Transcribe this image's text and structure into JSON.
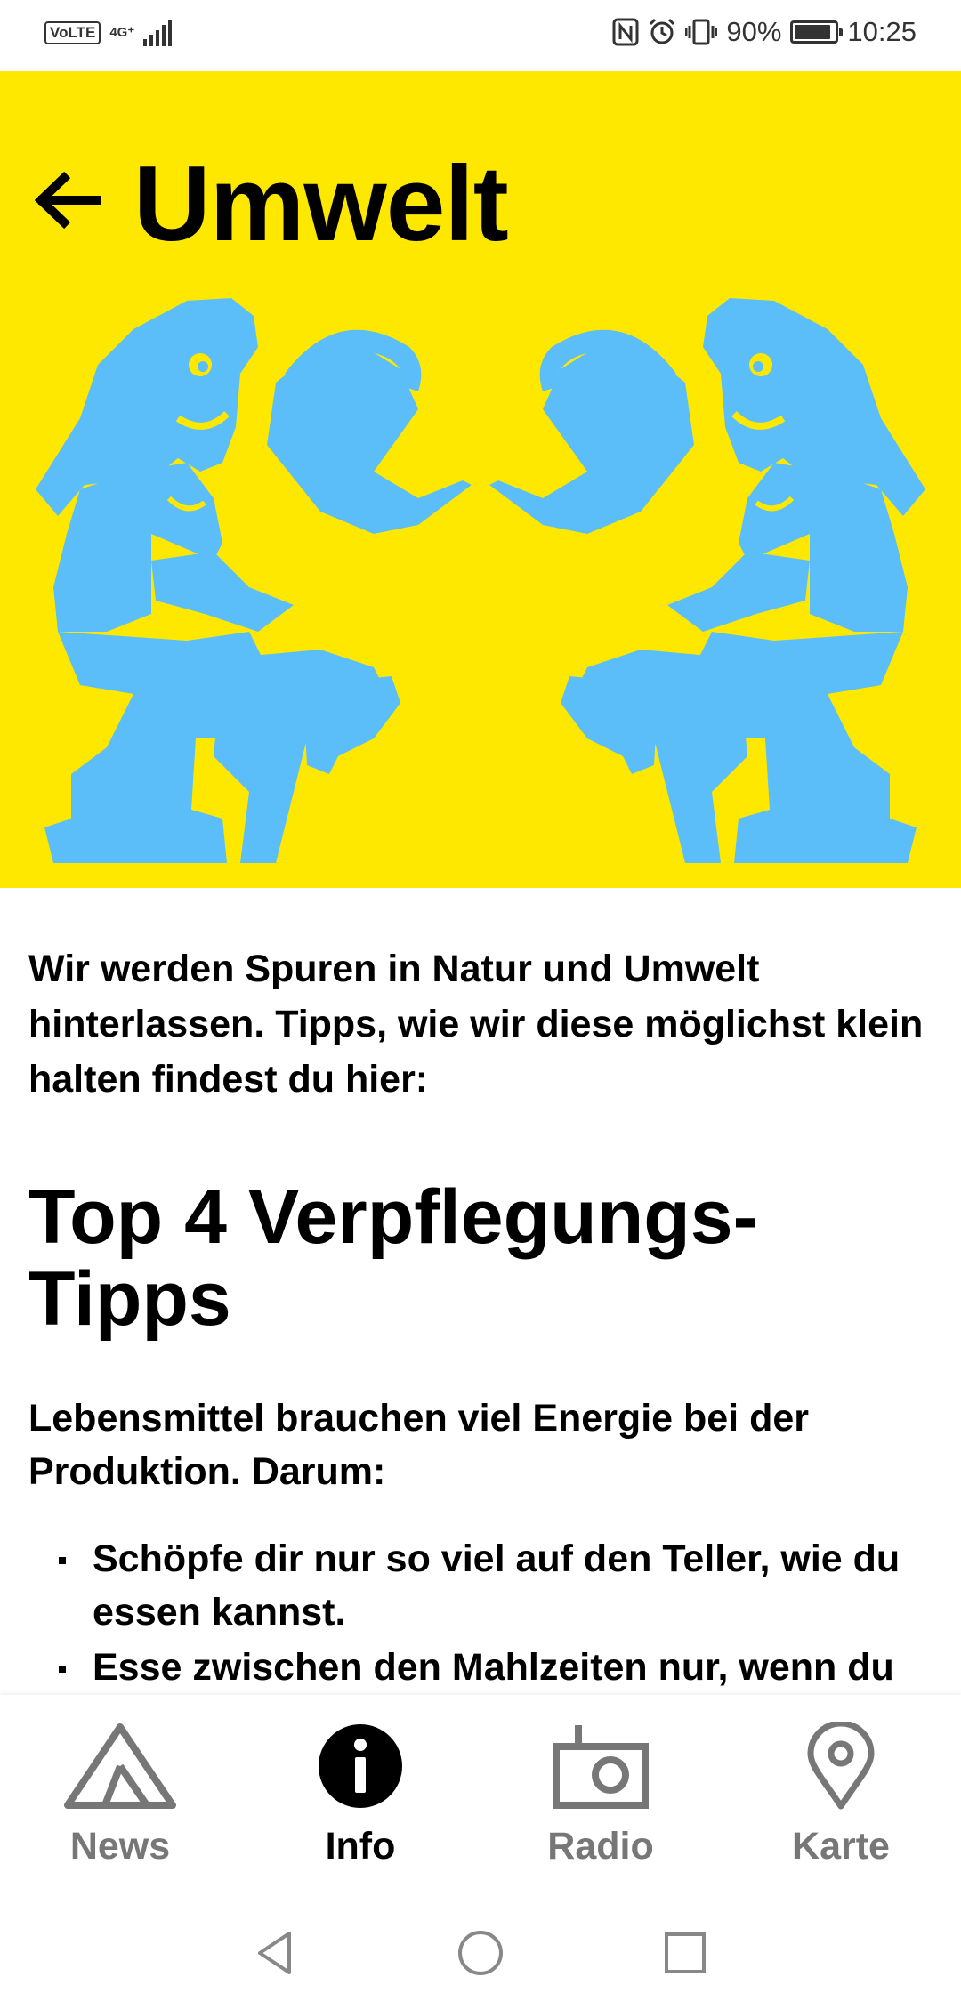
{
  "status_bar": {
    "volte": "VoLTE",
    "network": "4G⁺",
    "battery_text": "90%",
    "battery_level": 0.9,
    "time": "10:25"
  },
  "header": {
    "title": "Umwelt",
    "background": "#FFE800",
    "illustration_color": "#5BBEF8"
  },
  "content": {
    "intro": "Wir werden Spuren in Natur und Umwelt hinterlassen. Tipps, wie wir diese möglichst klein halten findest du hier:",
    "section_title": "Top 4 Verpflegungs-Tipps",
    "lead": "Lebensmittel brauchen viel Energie bei der Produktion. Darum:",
    "tips": [
      "Schöpfe dir nur so viel auf den Teller, wie du essen kannst.",
      "Esse zwischen den Mahlzeiten nur, wenn du wirklich hungrig bist. So entsteht"
    ]
  },
  "bottom_nav": {
    "items": [
      {
        "label": "News",
        "icon": "tent-icon"
      },
      {
        "label": "Info",
        "icon": "info-icon",
        "active": true
      },
      {
        "label": "Radio",
        "icon": "radio-icon"
      },
      {
        "label": "Karte",
        "icon": "map-pin-icon"
      }
    ]
  },
  "system_nav": [
    "back-icon",
    "home-icon",
    "recents-icon"
  ]
}
